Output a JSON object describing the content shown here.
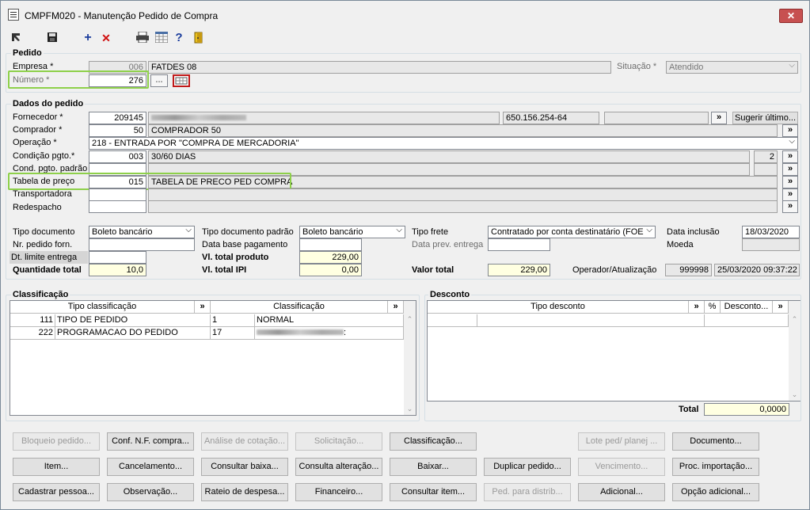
{
  "window": {
    "title": "CMPFM020 - Manutenção Pedido de Compra",
    "close": "✕"
  },
  "toolbar": {
    "plus": "+",
    "del": "✕",
    "help": "?"
  },
  "pedido": {
    "section": "Pedido",
    "empresa_label": "Empresa *",
    "empresa_code": "006",
    "empresa_name": "FATDES 08",
    "situacao_label": "Situação *",
    "situacao_value": "Atendido",
    "numero_label": "Número *",
    "numero_value": "276",
    "ellipsis": "..."
  },
  "dados": {
    "section": "Dados do pedido",
    "fornecedor_label": "Fornecedor *",
    "fornecedor_code": "209145",
    "fornecedor_doc": "650.156.254-64",
    "sugerir": "Sugerir último...",
    "comprador_label": "Comprador *",
    "comprador_code": "50",
    "comprador_name": "COMPRADOR 50",
    "operacao_label": "Operação *",
    "operacao_value": "218 - ENTRADA POR \"COMPRA DE MERCADORIA\"",
    "condicao_label": "Condição pgto.*",
    "condicao_code": "003",
    "condicao_name": "30/60 DIAS",
    "condicao_count": "2",
    "condpadrao_label": "Cond. pgto. padrão",
    "tabela_label": "Tabela de preço",
    "tabela_code": "015",
    "tabela_name": "TABELA DE PRECO PED COMPRA",
    "transportadora_label": "Transportadora",
    "redespacho_label": "Redespacho",
    "tipodoc_label": "Tipo documento",
    "tipodoc_value": "Boleto bancário",
    "tipodocpadrao_label": "Tipo documento padrão",
    "tipodocpadrao_value": "Boleto bancário",
    "tipofrete_label": "Tipo frete",
    "tipofrete_value": "Contratado por conta destinatário (FOE",
    "datainclusao_label": "Data inclusão",
    "datainclusao_value": "18/03/2020",
    "nrpedido_label": "Nr. pedido forn.",
    "database_label": "Data base pagamento",
    "dataprev_label": "Data prev. entrega",
    "moeda_label": "Moeda",
    "dtlimite_label": "Dt. limite entrega",
    "vltotalprod_label": "Vl. total produto",
    "vltotalprod_value": "229,00",
    "qtdtotal_label": "Quantidade total",
    "qtdtotal_value": "10,0",
    "vltotalipi_label": "Vl. total IPI",
    "vltotalipi_value": "0,00",
    "valortotal_label": "Valor total",
    "valortotal_value": "229,00",
    "operador_label": "Operador/Atualização",
    "operador_code": "999998",
    "operador_date": "25/03/2020 09:37:22",
    "more": "»"
  },
  "classificacao": {
    "section": "Classificação",
    "col_tipo": "Tipo classificação",
    "col_class": "Classificação",
    "rows": [
      {
        "code": "111",
        "tipo": "TIPO DE PEDIDO",
        "num": "1",
        "value": "NORMAL"
      },
      {
        "code": "222",
        "tipo": "PROGRAMACAO DO PEDIDO",
        "num": "17",
        "value": ":"
      }
    ]
  },
  "desconto": {
    "section": "Desconto",
    "col_tipo": "Tipo desconto",
    "col_pct": "%",
    "col_desc": "Desconto...",
    "total_label": "Total",
    "total_value": "0,0000"
  },
  "buttons": {
    "row1": [
      "Bloqueio pedido...",
      "Conf. N.F. compra...",
      "Análise de cotação...",
      "Solicitação...",
      "Classificação...",
      "Lote ped/ planej ...",
      "Documento..."
    ],
    "row2": [
      "Item...",
      "Cancelamento...",
      "Consultar baixa...",
      "Consulta alteração...",
      "Baixar...",
      "Duplicar pedido...",
      "Vencimento...",
      "Proc. importação..."
    ],
    "row3": [
      "Cadastrar pessoa...",
      "Observação...",
      "Rateio de despesa...",
      "Financeiro...",
      "Consultar item...",
      "Ped. para distrib...",
      "Adicional...",
      "Opção adicional..."
    ]
  }
}
